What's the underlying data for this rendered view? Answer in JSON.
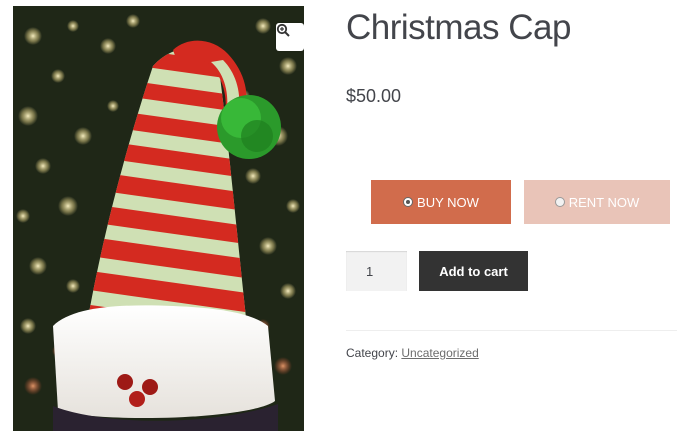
{
  "product": {
    "title": "Christmas Cap",
    "price": "$50.00",
    "image_alt": "red-and-white striped knit elf hat with green pom-pom"
  },
  "options": {
    "buy_label": "BUY NOW",
    "rent_label": "RENT NOW",
    "selected": "buy",
    "buy_color": "#d16c4c",
    "rent_color": "#e9c4b8"
  },
  "cart": {
    "quantity": "1",
    "add_to_cart_label": "Add to cart",
    "button_color": "#333333"
  },
  "meta": {
    "category_label": "Category:",
    "category_value": "Uncategorized"
  },
  "icons": {
    "zoom": "zoom-in-icon"
  }
}
